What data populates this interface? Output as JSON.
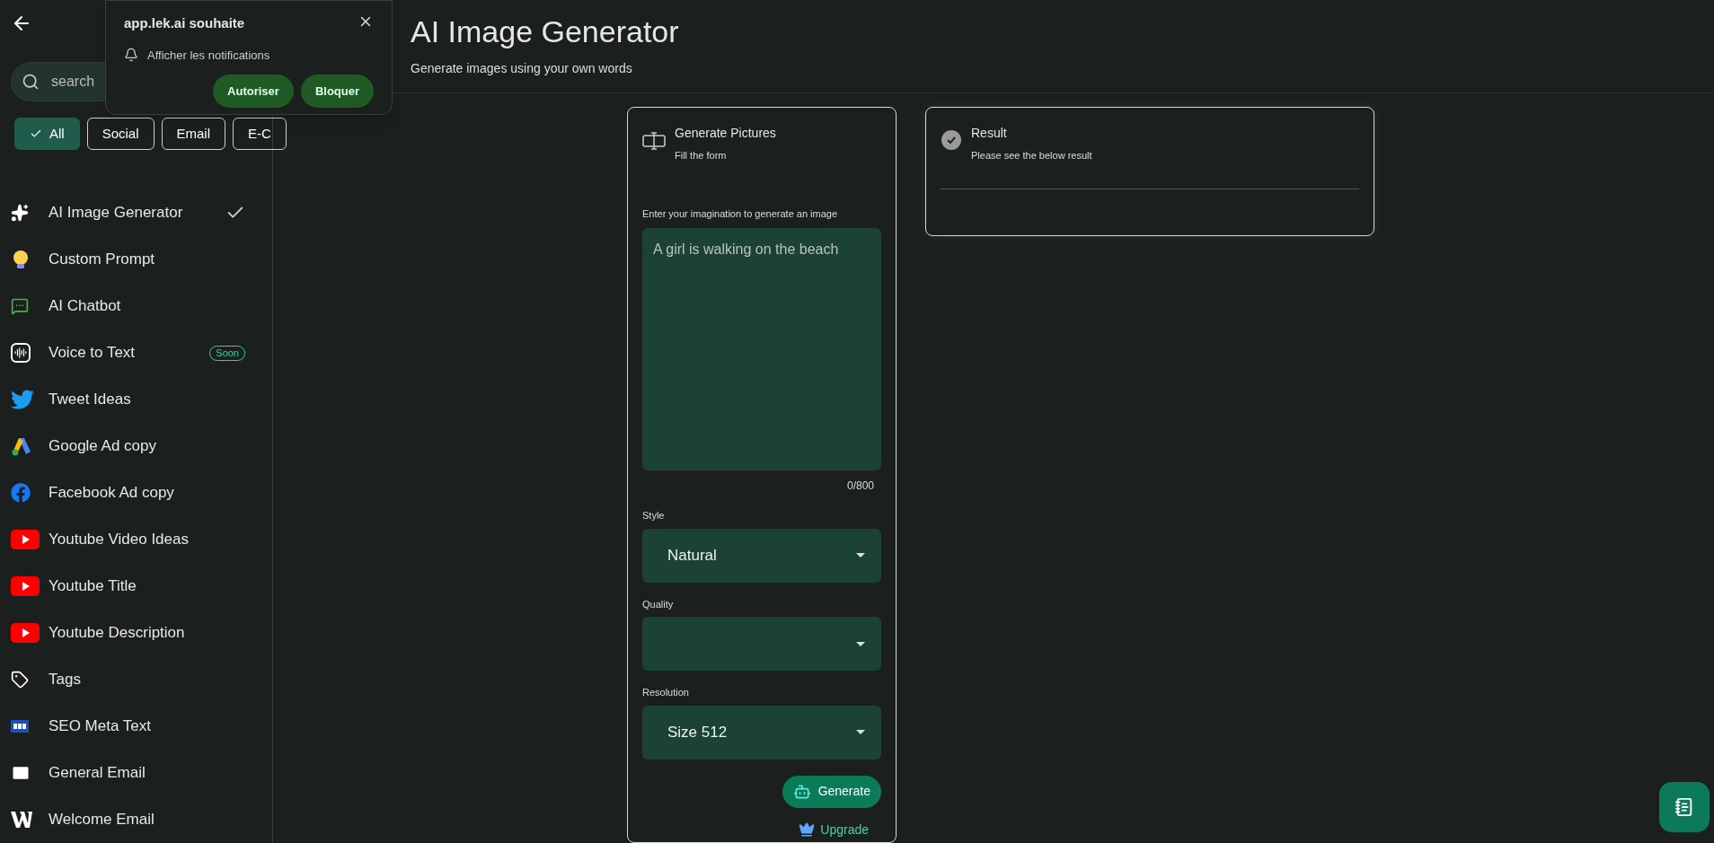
{
  "sidebar": {
    "search": {
      "placeholder": "search"
    },
    "filters": [
      {
        "label": "All",
        "selected": true
      },
      {
        "label": "Social",
        "selected": false
      },
      {
        "label": "Email",
        "selected": false
      },
      {
        "label": "E-C",
        "selected": false
      }
    ],
    "items": [
      {
        "label": "AI Image Generator",
        "selected": true
      },
      {
        "label": "Custom Prompt",
        "selected": false
      },
      {
        "label": "AI Chatbot",
        "selected": false
      },
      {
        "label": "Voice to Text",
        "selected": false,
        "badge": "Soon"
      },
      {
        "label": "Tweet Ideas",
        "selected": false
      },
      {
        "label": "Google Ad copy",
        "selected": false
      },
      {
        "label": "Facebook Ad copy",
        "selected": false
      },
      {
        "label": "Youtube Video Ideas",
        "selected": false
      },
      {
        "label": "Youtube Title",
        "selected": false
      },
      {
        "label": "Youtube Description",
        "selected": false
      },
      {
        "label": "Tags",
        "selected": false
      },
      {
        "label": "SEO Meta Text",
        "selected": false
      },
      {
        "label": "General Email",
        "selected": false
      },
      {
        "label": "Welcome Email",
        "selected": false
      }
    ]
  },
  "popup": {
    "title": "app.lek.ai souhaite",
    "message": "Afficher les notifications",
    "buttons": [
      "Autoriser",
      "Bloquer"
    ]
  },
  "header": {
    "title": "AI Image Generator",
    "subtitle": "Generate images using your own words"
  },
  "form": {
    "title": "Generate Pictures",
    "subtitle": "Fill the form",
    "prompt_label": "Enter your imagination to generate an image",
    "prompt_placeholder": "A girl is walking on the beach",
    "counter": "0/800",
    "selects": [
      {
        "label": "Style",
        "value": "Natural"
      },
      {
        "label": "Quality"
      },
      {
        "label": "Resolution",
        "value": "Size 512"
      }
    ],
    "generate": "Generate",
    "upgrade": "Upgrade"
  },
  "result": {
    "title": "Result",
    "subtitle": "Please see the below result"
  }
}
